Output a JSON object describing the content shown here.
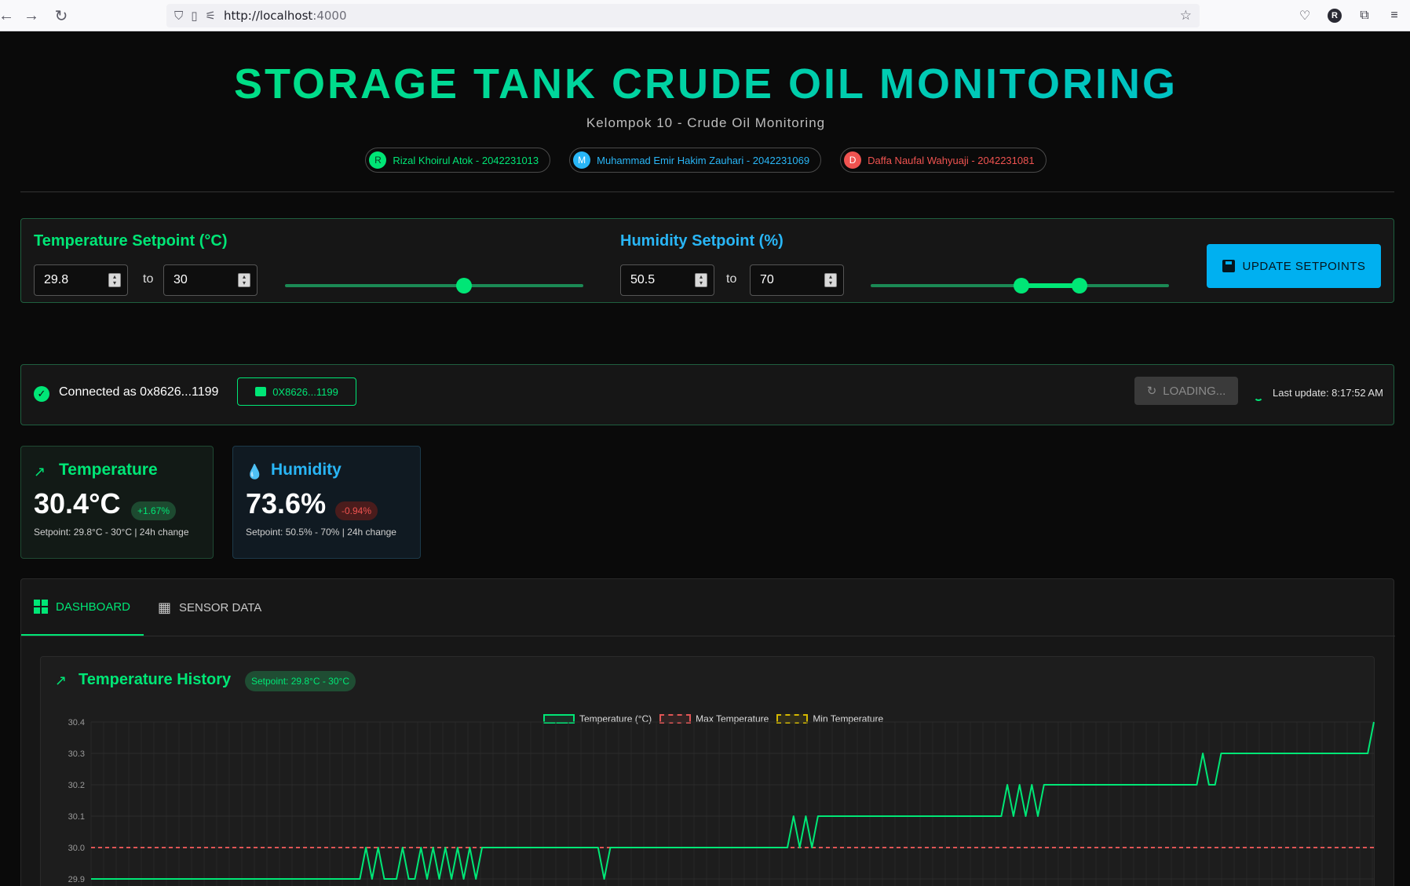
{
  "browser": {
    "url_host": "http://localhost",
    "url_port": ":4000",
    "profile_initial": "R"
  },
  "header": {
    "title": "STORAGE TANK CRUDE OIL MONITORING",
    "subtitle": "Kelompok 10 - Crude Oil Monitoring",
    "members": [
      {
        "initial": "R",
        "label": "Rizal Khoirul Atok - 2042231013",
        "color": "#00e676"
      },
      {
        "initial": "M",
        "label": "Muhammad Emir Hakim Zauhari - 2042231069",
        "color": "#29b6f6"
      },
      {
        "initial": "D",
        "label": "Daffa Naufal Wahyuaji - 2042231081",
        "color": "#ef5350"
      }
    ]
  },
  "setpoints": {
    "temperature": {
      "label": "Temperature Setpoint (°C)",
      "min": "29.8",
      "max": "30",
      "to": "to",
      "color": "#00e676"
    },
    "humidity": {
      "label": "Humidity Setpoint (%)",
      "min": "50.5",
      "max": "70",
      "to": "to",
      "color": "#29b6f6"
    },
    "update_label": "UPDATE SETPOINTS"
  },
  "connection": {
    "status_text": "Connected as 0x8626...1199",
    "wallet_label": "0X8626...1199",
    "loading_label": "LOADING...",
    "last_update": "Last update: 8:17:52 AM"
  },
  "stats": {
    "temperature": {
      "label": "Temperature",
      "value": "30.4°C",
      "change": "+1.67%",
      "note": "Setpoint: 29.8°C - 30°C | 24h change",
      "color": "#00e676"
    },
    "humidity": {
      "label": "Humidity",
      "value": "73.6%",
      "change": "-0.94%",
      "note": "Setpoint: 50.5% - 70% | 24h change",
      "color": "#29b6f6"
    }
  },
  "tabs": [
    {
      "label": "DASHBOARD",
      "active": true
    },
    {
      "label": "SENSOR DATA",
      "active": false
    }
  ],
  "chart_data": {
    "type": "line",
    "title": "Temperature History",
    "badge": "Setpoint: 29.8°C - 30°C",
    "legend": [
      "Temperature (°C)",
      "Max Temperature",
      "Min Temperature"
    ],
    "y_ticks": [
      "30.4",
      "30.3",
      "30.2",
      "30.1",
      "30.0",
      "29.9"
    ],
    "ylim_visible": [
      29.9,
      30.4
    ],
    "max_temperature": 30.0,
    "min_temperature": 29.8,
    "colors": {
      "temperature": "#00e676",
      "max": "#e05555",
      "min": "#d4b800"
    },
    "series_temperature": [
      29.9,
      29.9,
      29.9,
      29.9,
      29.9,
      29.9,
      29.9,
      29.9,
      29.9,
      29.9,
      29.9,
      29.9,
      29.9,
      29.9,
      29.9,
      29.9,
      29.9,
      29.9,
      29.9,
      29.9,
      29.9,
      29.9,
      29.9,
      29.9,
      29.9,
      29.9,
      29.9,
      29.9,
      29.9,
      29.9,
      29.9,
      29.9,
      29.9,
      29.9,
      29.9,
      29.9,
      29.9,
      29.9,
      29.9,
      29.9,
      29.9,
      29.9,
      29.9,
      29.9,
      29.9,
      30.0,
      29.9,
      30.0,
      29.9,
      29.9,
      29.9,
      30.0,
      29.9,
      29.9,
      30.0,
      29.9,
      30.0,
      29.9,
      30.0,
      29.9,
      30.0,
      29.9,
      30.0,
      29.9,
      30.0,
      30.0,
      30.0,
      30.0,
      30.0,
      30.0,
      30.0,
      30.0,
      30.0,
      30.0,
      30.0,
      30.0,
      30.0,
      30.0,
      30.0,
      30.0,
      30.0,
      30.0,
      30.0,
      30.0,
      29.9,
      30.0,
      30.0,
      30.0,
      30.0,
      30.0,
      30.0,
      30.0,
      30.0,
      30.0,
      30.0,
      30.0,
      30.0,
      30.0,
      30.0,
      30.0,
      30.0,
      30.0,
      30.0,
      30.0,
      30.0,
      30.0,
      30.0,
      30.0,
      30.0,
      30.0,
      30.0,
      30.0,
      30.0,
      30.0,
      30.0,
      30.1,
      30.0,
      30.1,
      30.0,
      30.1,
      30.1,
      30.1,
      30.1,
      30.1,
      30.1,
      30.1,
      30.1,
      30.1,
      30.1,
      30.1,
      30.1,
      30.1,
      30.1,
      30.1,
      30.1,
      30.1,
      30.1,
      30.1,
      30.1,
      30.1,
      30.1,
      30.1,
      30.1,
      30.1,
      30.1,
      30.1,
      30.1,
      30.1,
      30.1,
      30.1,
      30.2,
      30.1,
      30.2,
      30.1,
      30.2,
      30.1,
      30.2,
      30.2,
      30.2,
      30.2,
      30.2,
      30.2,
      30.2,
      30.2,
      30.2,
      30.2,
      30.2,
      30.2,
      30.2,
      30.2,
      30.2,
      30.2,
      30.2,
      30.2,
      30.2,
      30.2,
      30.2,
      30.2,
      30.2,
      30.2,
      30.2,
      30.2,
      30.3,
      30.2,
      30.2,
      30.3,
      30.3,
      30.3,
      30.3,
      30.3,
      30.3,
      30.3,
      30.3,
      30.3,
      30.3,
      30.3,
      30.3,
      30.3,
      30.3,
      30.3,
      30.3,
      30.3,
      30.3,
      30.3,
      30.3,
      30.3,
      30.3,
      30.3,
      30.3,
      30.3,
      30.4
    ]
  }
}
